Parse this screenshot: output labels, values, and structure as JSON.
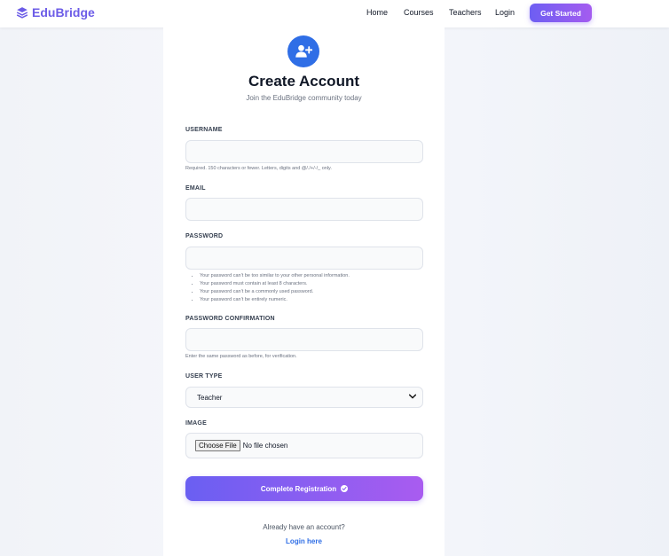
{
  "nav": {
    "brand": "EduBridge",
    "links": [
      "Home",
      "Courses",
      "Teachers",
      "Login"
    ],
    "cta": "Get Started"
  },
  "form": {
    "title": "Create Account",
    "subtitle": "Join the EduBridge community today",
    "username": {
      "label": "USERNAME",
      "value": "",
      "help": "Required. 150 characters or fewer. Letters, digits and @/./+/-/_ only."
    },
    "email": {
      "label": "EMAIL",
      "value": ""
    },
    "password": {
      "label": "PASSWORD",
      "value": "",
      "help": [
        "Your password can’t be too similar to your other personal information.",
        "Your password must contain at least 8 characters.",
        "Your password can’t be a commonly used password.",
        "Your password can’t be entirely numeric."
      ]
    },
    "password_confirmation": {
      "label": "PASSWORD CONFIRMATION",
      "value": "",
      "help": "Enter the same password as before, for verification."
    },
    "user_type": {
      "label": "USER TYPE",
      "selected": "Teacher"
    },
    "image": {
      "label": "IMAGE",
      "button": "Choose File",
      "status": "No file chosen"
    },
    "submit": "Complete Registration",
    "footer_text": "Already have an account?",
    "footer_link": "Login here"
  },
  "colors": {
    "brand": "#6c5ce7",
    "gradient_start": "#6a5ff2",
    "gradient_end": "#a95cf0",
    "link": "#2f6ee6"
  }
}
